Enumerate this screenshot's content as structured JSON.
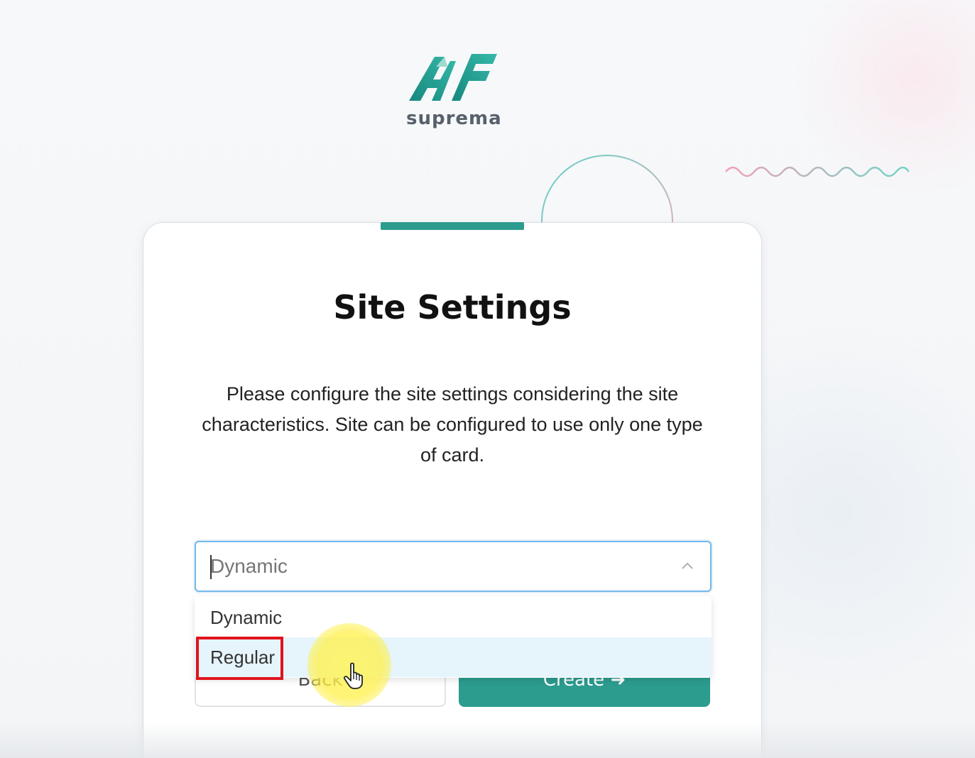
{
  "brand": {
    "name": "suprema",
    "accent_color": "#2c9c8f"
  },
  "card": {
    "title": "Site Settings",
    "description": "Please configure the site settings considering the site characteristics. Site can be configured to use only one type of card."
  },
  "select": {
    "placeholder": "Dynamic",
    "options": [
      "Dynamic",
      "Regular"
    ],
    "hovered_option": "Regular"
  },
  "buttons": {
    "back_label": "Back",
    "create_label": "Create"
  },
  "icons": {
    "chevron": "chevron-up-icon",
    "cursor": "hand-pointer-icon",
    "create_arrow": "arrow-right-icon"
  },
  "colors": {
    "focus_border": "#74b8e8",
    "option_hover": "#e6f4fc",
    "annotation": "#e0141b"
  }
}
